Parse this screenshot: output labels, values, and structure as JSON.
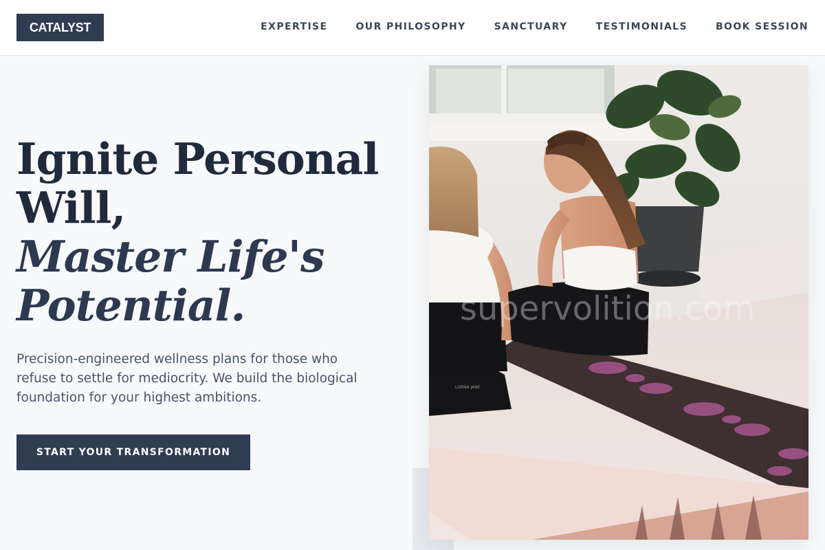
{
  "brand": {
    "logo": "CATALYST"
  },
  "nav": {
    "items": [
      {
        "label": "EXPERTISE"
      },
      {
        "label": "OUR PHILOSOPHY"
      },
      {
        "label": "SANCTUARY"
      },
      {
        "label": "TESTIMONIALS"
      },
      {
        "label": "BOOK SESSION"
      }
    ]
  },
  "hero": {
    "title_line1": "Ignite Personal",
    "title_line2": "Will,",
    "title_line3": "Master Life's",
    "title_line4": "Potential.",
    "subtitle": "Precision-engineered wellness plans for those who refuse to settle for mediocrity. We build the biological foundation for your highest ambitions.",
    "cta_label": "START YOUR TRANSFORMATION"
  },
  "photo": {
    "watermark": "supervolition.com",
    "legging_print": "LORNA JANE"
  },
  "colors": {
    "primary": "#2f3c52",
    "heading": "#1f2a3d",
    "body_text": "#475368",
    "page_bg": "#f7f9fb",
    "mat_accent": "#b45a9a"
  }
}
